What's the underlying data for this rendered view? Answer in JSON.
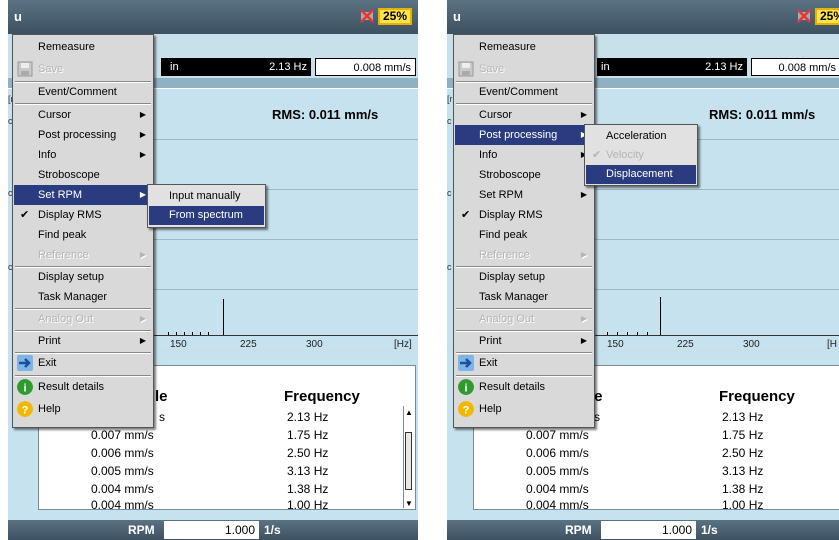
{
  "colors": {
    "menu_selected": "#2a3b80",
    "title_bar": "#4a5f6e",
    "graph_bg": "#c6e2ee",
    "battery": "#ffe34a"
  },
  "title_bar": {
    "app": "u",
    "battery": "25%",
    "signal_icon": "no-signal-icon"
  },
  "header": {
    "frag_ain": "ain",
    "frag_in": "in",
    "freq": "2.13 Hz",
    "amp": "0.008 mm/s",
    "amp_cut": "0.008 mm/s"
  },
  "graph": {
    "rms": "RMS: 0.011 mm/s",
    "x_ticks": [
      "150",
      "225",
      "300",
      "[Hz]"
    ],
    "x_tick_cut": "[H",
    "y_frag": [
      "[r",
      "c",
      "c",
      "c"
    ]
  },
  "menu": {
    "items": [
      {
        "label": "Remeasure"
      },
      {
        "label": "Save",
        "icon": "save-icon",
        "disabled": true
      },
      {
        "label": "Event/Comment"
      },
      {
        "label": "Cursor",
        "submenu": true
      },
      {
        "label": "Post processing",
        "submenu": true
      },
      {
        "label": "Info",
        "submenu": true
      },
      {
        "label": "Stroboscope"
      },
      {
        "label": "Set RPM",
        "submenu": true
      },
      {
        "label": "Display RMS",
        "checked": true
      },
      {
        "label": "Find peak"
      },
      {
        "label": "Reference",
        "submenu": true,
        "disabled": true
      },
      {
        "label": "Display setup"
      },
      {
        "label": "Task Manager"
      },
      {
        "label": "Analog Out",
        "submenu": true,
        "disabled": true
      },
      {
        "label": "Print",
        "submenu": true
      },
      {
        "label": "Exit",
        "icon": "exit-icon"
      },
      {
        "label": "Result details",
        "icon": "info-icon"
      },
      {
        "label": "Help",
        "icon": "help-icon"
      }
    ]
  },
  "submenu_rpm": {
    "items": [
      "Input manually",
      "From spectrum"
    ],
    "selected": "From spectrum"
  },
  "submenu_post": {
    "items": [
      {
        "label": "Acceleration"
      },
      {
        "label": "Velocity",
        "checked": true,
        "disabled": true
      },
      {
        "label": "Displacement"
      }
    ],
    "selected": "Displacement"
  },
  "results": {
    "col_amp_fragment": "le",
    "col_freq": "Frequency",
    "rows": [
      {
        "amp": "s",
        "freq": "2.13 Hz"
      },
      {
        "amp": "0.007 mm/s",
        "freq": "1.75 Hz"
      },
      {
        "amp": "0.006 mm/s",
        "freq": "2.50 Hz"
      },
      {
        "amp": "0.005 mm/s",
        "freq": "3.13 Hz"
      },
      {
        "amp": "0.004 mm/s",
        "freq": "1.38 Hz"
      },
      {
        "amp": "0.004 mm/s",
        "freq": "1.00 Hz"
      }
    ]
  },
  "status": {
    "rpm_label": "RPM",
    "rpm_value": "1.000",
    "rpm_unit": "1/s"
  },
  "symbols": {
    "arrow_right": "▶",
    "check": "✔",
    "scroll_up": "▲",
    "scroll_down": "▼"
  }
}
